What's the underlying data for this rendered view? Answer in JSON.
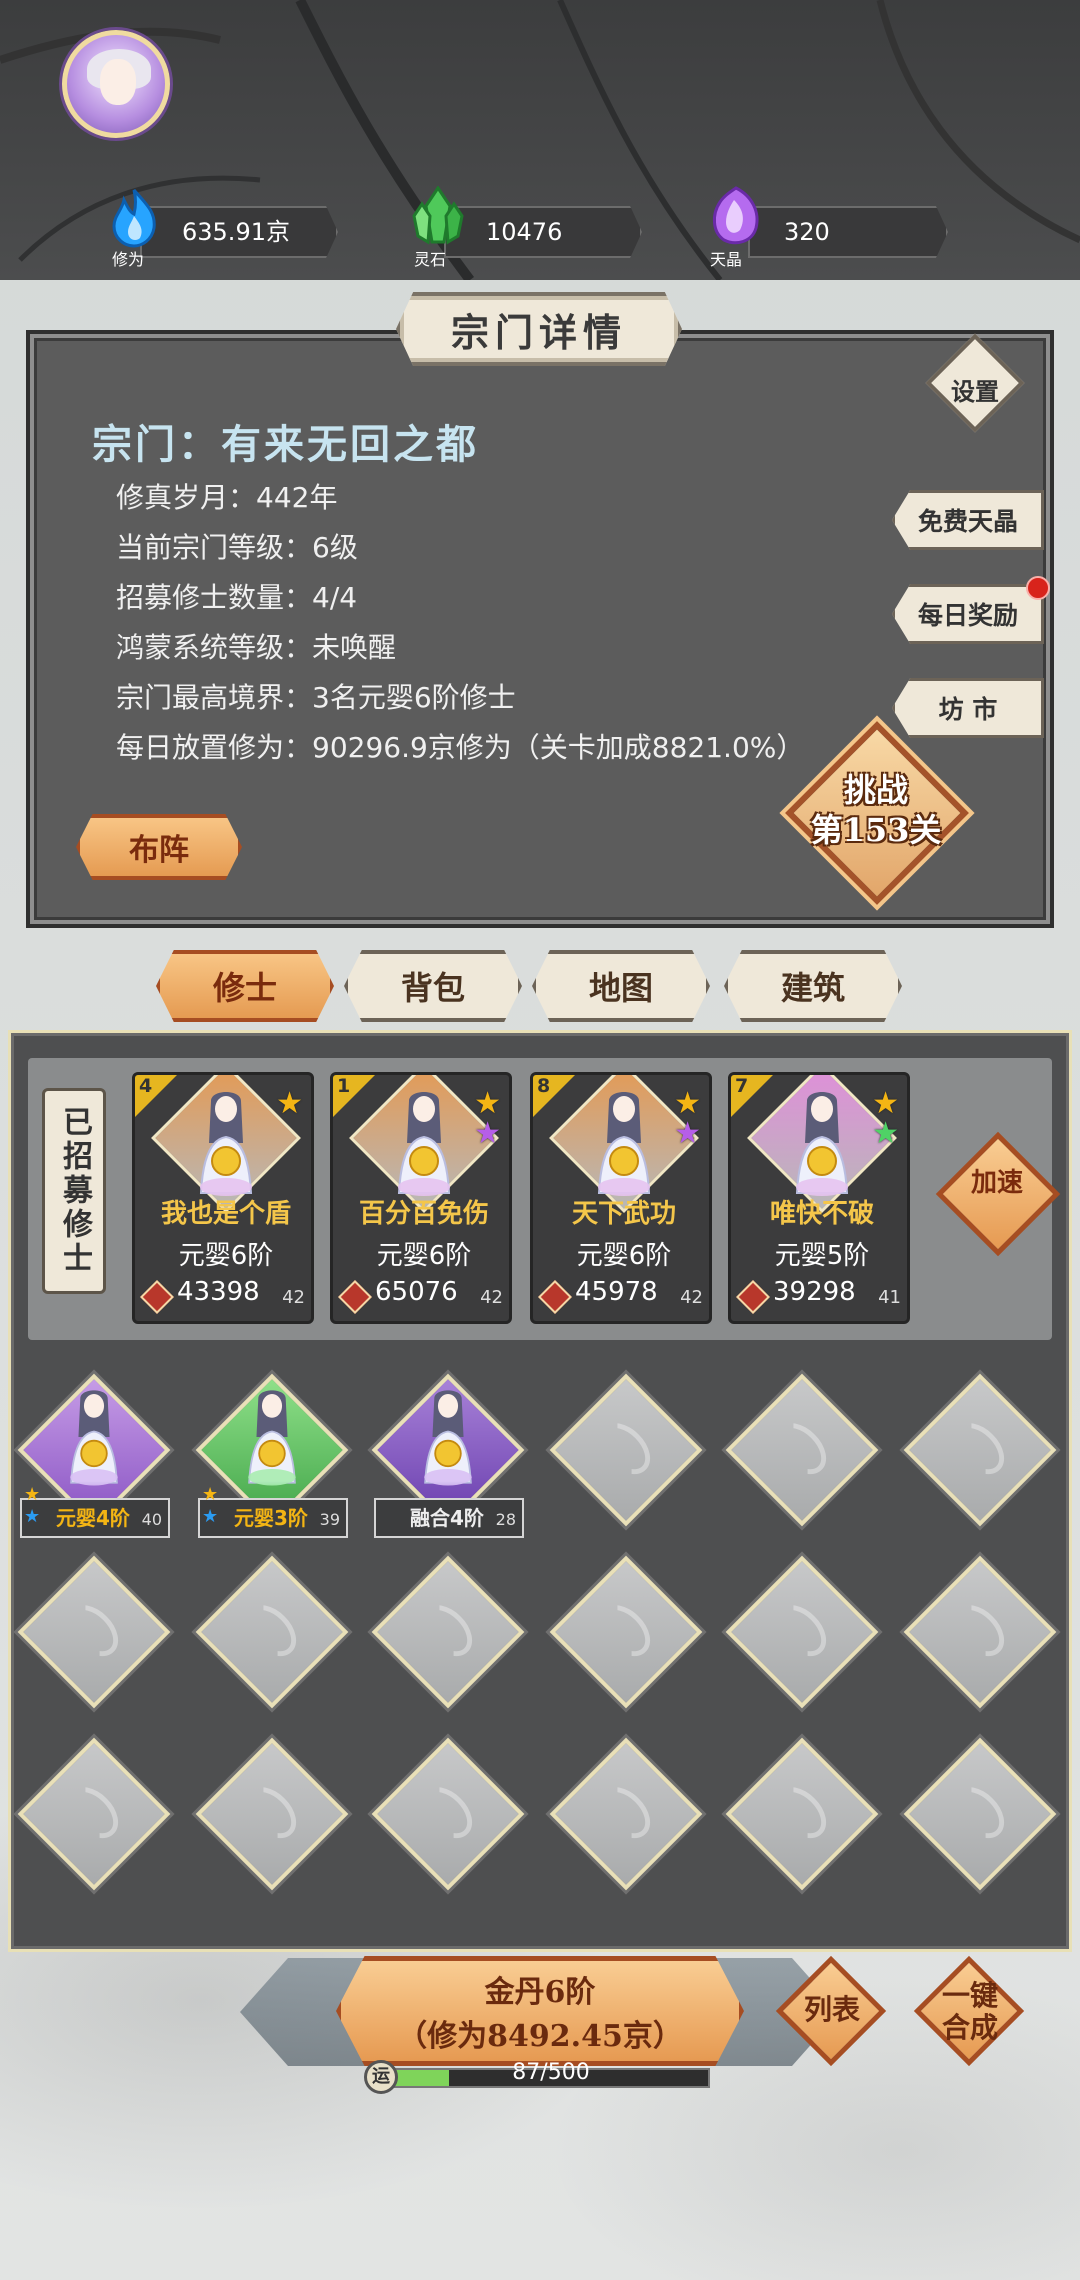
{
  "resources": [
    {
      "icon": "flame-icon",
      "label": "修为",
      "value": "635.91京",
      "color": "#27a4ff"
    },
    {
      "icon": "crystal-icon",
      "label": "灵石",
      "value": "10476",
      "color": "#4fc95a"
    },
    {
      "icon": "purple-gem-icon",
      "label": "天晶",
      "value": "320",
      "color": "#b56bef"
    }
  ],
  "panel": {
    "title": "宗门详情",
    "sect_name": "宗门：有来无回之都",
    "lines": [
      "修真岁月：442年",
      "当前宗门等级：6级",
      "招募修士数量：4/4",
      "鸿蒙系统等级：未唤醒",
      "宗门最高境界：3名元婴6阶修士",
      "每日放置修为：90296.9京修为（关卡加成8821.0%）"
    ],
    "settings_label": "设置",
    "side_buttons": [
      "免费天晶",
      "每日奖励",
      "坊 市"
    ],
    "challenge_line1": "挑战",
    "challenge_line2": "第153关",
    "formation_label": "布阵"
  },
  "tabs": [
    "修士",
    "背包",
    "地图",
    "建筑"
  ],
  "recruited_label": "已招募修士",
  "speed_label": "加速",
  "cards": [
    {
      "rank": "4",
      "name": "我也是个盾",
      "realm": "元婴6阶",
      "power": "43398",
      "level": "42",
      "bg": "#e39a55",
      "stars": [
        "#f4b514"
      ]
    },
    {
      "rank": "1",
      "name": "百分百免伤",
      "realm": "元婴6阶",
      "power": "65076",
      "level": "42",
      "bg": "#e39a55",
      "stars": [
        "#f4b514",
        "#b65ee8"
      ]
    },
    {
      "rank": "8",
      "name": "天下武功",
      "realm": "元婴6阶",
      "power": "45978",
      "level": "42",
      "bg": "#e39a55",
      "stars": [
        "#f4b514",
        "#b65ee8"
      ]
    },
    {
      "rank": "7",
      "name": "唯快不破",
      "realm": "元婴5阶",
      "power": "39298",
      "level": "41",
      "bg": "#df8fd9",
      "stars": [
        "#f4b514",
        "#4fd266"
      ]
    }
  ],
  "slots": [
    {
      "realm": "元婴4阶",
      "level": "40",
      "type": "purple"
    },
    {
      "realm": "元婴3阶",
      "level": "39",
      "type": "green"
    },
    {
      "realm": "融合4阶",
      "level": "28",
      "type": "violet"
    }
  ],
  "bottom": {
    "main_line1": "金丹6阶",
    "main_line2": "（修为8492.45京）",
    "list_label": "列表",
    "merge_line1": "一键",
    "merge_line2": "合成",
    "luck_icon_text": "运",
    "luck_text": "87/500",
    "luck_fraction": 0.174
  }
}
